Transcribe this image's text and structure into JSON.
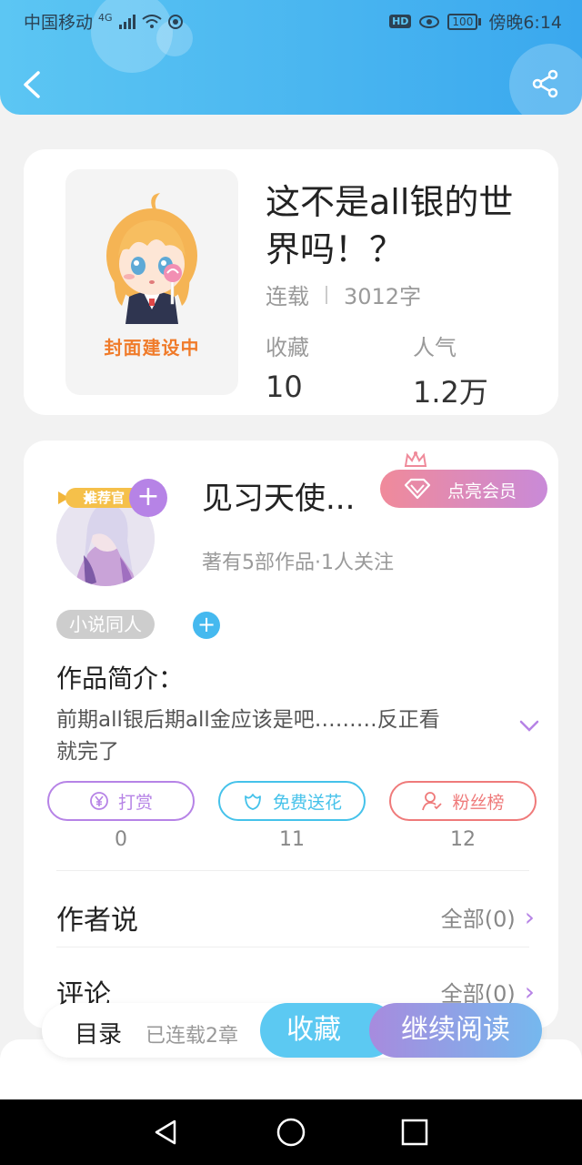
{
  "status_bar": {
    "carrier": "中国移动",
    "network": "4G",
    "hd": "HD",
    "battery": "100",
    "time": "傍晚6:14"
  },
  "header": {
    "back_icon": "chevron-left-icon",
    "share_icon": "share-icon"
  },
  "book": {
    "cover_label": "封面建设中",
    "title": "这不是all银的世界吗！？",
    "status": "连载",
    "word_count": "3012字",
    "favorites_label": "收藏",
    "favorites_value": "10",
    "popularity_label": "人气",
    "popularity_value": "1.2万"
  },
  "author": {
    "badge": "推荐官",
    "name": "见习天使...",
    "info": "著有5部作品·1人关注",
    "vip_label": "点亮会员",
    "tag": "小说同人"
  },
  "intro": {
    "title": "作品简介：",
    "text": "前期all银后期all金应该是吧………反正看就完了"
  },
  "actions": [
    {
      "label": "打赏",
      "count": "0",
      "color": "#b683e6",
      "icon": "yen-icon"
    },
    {
      "label": "免费送花",
      "count": "11",
      "color": "#45c2ea",
      "icon": "flower-icon"
    },
    {
      "label": "粉丝榜",
      "count": "12",
      "color": "#ef7a7a",
      "icon": "user-icon"
    }
  ],
  "rows": [
    {
      "title": "作者说",
      "link": "全部(0)"
    },
    {
      "title": "评论",
      "link": "全部(0)"
    }
  ],
  "bottom_bar": {
    "toc": "目录",
    "chapters": "已连载2章",
    "favorite": "收藏",
    "continue": "继续阅读"
  },
  "colors": {
    "header_blue": "#3aa8ee",
    "accent_purple": "#b683e6",
    "accent_blue": "#45b9ef"
  }
}
